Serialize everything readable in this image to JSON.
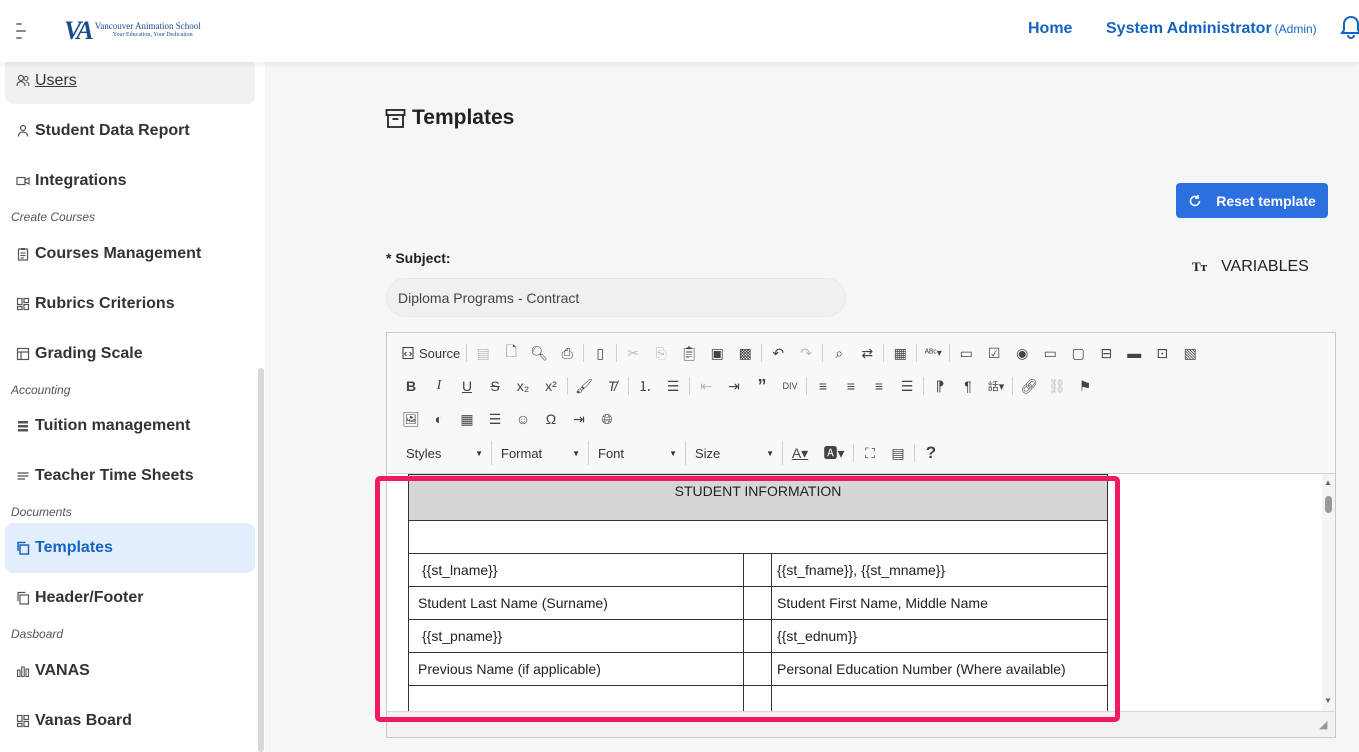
{
  "header": {
    "logo_name": "Vancouver Animation School",
    "logo_tagline": "Your Education, Your Dedication",
    "home_label": "Home",
    "user_name": "System Administrator",
    "user_role": "(Admin)"
  },
  "sidebar": {
    "items": [
      {
        "label": "Users",
        "icon": "users-icon"
      },
      {
        "label": "Student Data Report",
        "icon": "user-icon"
      },
      {
        "label": "Integrations",
        "icon": "video-icon"
      },
      {
        "label": "Courses Management",
        "icon": "clipboard-icon"
      },
      {
        "label": "Rubrics Criterions",
        "icon": "grid-icon"
      },
      {
        "label": "Grading Scale",
        "icon": "table-icon"
      },
      {
        "label": "Tuition management",
        "icon": "list-icon"
      },
      {
        "label": "Teacher Time Sheets",
        "icon": "lines-icon"
      },
      {
        "label": "Templates",
        "icon": "copy-icon"
      },
      {
        "label": "Header/Footer",
        "icon": "copy-outline-icon"
      },
      {
        "label": "VANAS",
        "icon": "chart-icon"
      },
      {
        "label": "Vanas Board",
        "icon": "grid-icon"
      }
    ],
    "sections": [
      "Create Courses",
      "Accounting",
      "Documents",
      "Dasboard"
    ],
    "active_item": "Templates"
  },
  "main": {
    "title": "Templates",
    "reset_label": "Reset template",
    "subject_label": "* Subject:",
    "subject_value": "Diploma Programs - Contract",
    "variables_icon_text": "Tт",
    "variables_label": "VARIABLES"
  },
  "editor": {
    "source_label": "Source",
    "combos": [
      "Styles",
      "Format",
      "Font",
      "Size"
    ],
    "table": {
      "title": "STUDENT INFORMATION",
      "rows": [
        [
          "{{st_lname}}",
          "",
          "{{st_fname}}, {{st_mname}}"
        ],
        [
          "Student Last Name (Surname)",
          "",
          "Student First Name, Middle Name"
        ],
        [
          "{{st_pname}}",
          "",
          "{{st_ednum}}"
        ],
        [
          "Previous Name (if applicable)",
          "",
          "Personal Education Number (Where available)"
        ]
      ]
    }
  },
  "colors": {
    "accent": "#1565c0",
    "button": "#2b6fe0",
    "highlight": "#f01a5e",
    "active_bg": "#e3eefc"
  }
}
